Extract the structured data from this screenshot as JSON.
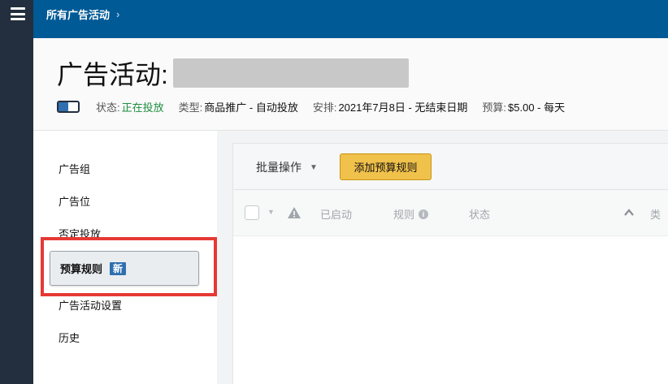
{
  "topbar": {
    "breadcrumb": "所有广告活动",
    "breadcrumb_chevron": "›"
  },
  "header": {
    "title_prefix": "广告活动:",
    "status_label": "状态:",
    "status_value": "正在投放",
    "type_label": "类型:",
    "type_value": "商品推广 - 自动投放",
    "schedule_label": "安排:",
    "schedule_value": "2021年7月8日 - 无结束日期",
    "budget_label": "预算:",
    "budget_value": "$5.00 - 每天"
  },
  "sidebar": {
    "items": [
      {
        "label": "广告组"
      },
      {
        "label": "广告位"
      },
      {
        "label": "否定投放"
      },
      {
        "label": "预算规则",
        "badge": "新"
      },
      {
        "label": "广告活动设置"
      },
      {
        "label": "历史"
      }
    ]
  },
  "toolbar": {
    "bulk_label": "批量操作",
    "add_rule_label": "添加预算规则"
  },
  "table": {
    "columns": {
      "started": "已启动",
      "rule": "规则",
      "status": "状态",
      "last": "类"
    }
  },
  "colors": {
    "topbar": "#005a95",
    "rail": "#232f3e",
    "status_green": "#1e8e3e",
    "button_yellow": "#f0c14b",
    "highlight_red": "#e53935",
    "badge_blue": "#2f6fb0"
  }
}
